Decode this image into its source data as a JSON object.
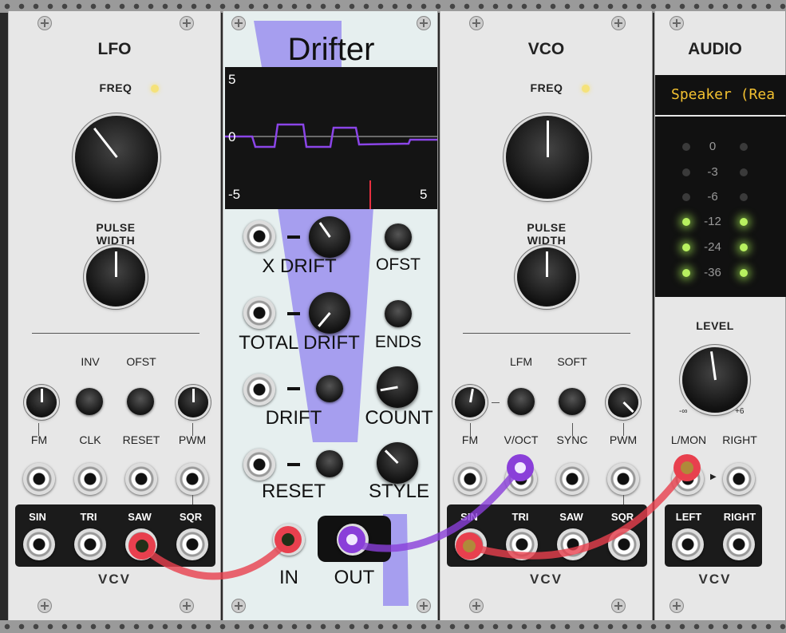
{
  "lfo": {
    "title": "LFO",
    "freq_label": "FREQ",
    "pw_label": "PULSE WIDTH",
    "inv_label": "INV",
    "ofst_label": "OFST",
    "fm_label": "FM",
    "clk_label": "CLK",
    "reset_label": "RESET",
    "pwm_label": "PWM",
    "outputs": [
      "SIN",
      "TRI",
      "SAW",
      "SQR"
    ],
    "brand": "VCV"
  },
  "drifter": {
    "title": "Drifter",
    "display": {
      "y_top": "5",
      "y_mid": "0",
      "x_left": "-5",
      "x_right": "5"
    },
    "x_drift_label": "X DRIFT",
    "ofst_label": "OFST",
    "total_drift_label": "TOTAL DRIFT",
    "ends_label": "ENDS",
    "drift_label": "DRIFT",
    "count_label": "COUNT",
    "reset_label": "RESET",
    "style_label": "STYLE",
    "in_label": "IN",
    "out_label": "OUT",
    "colors": {
      "accent": "#8a7cf0",
      "trace": "#8b45e8",
      "cursor": "#e83040"
    }
  },
  "vco": {
    "title": "VCO",
    "freq_label": "FREQ",
    "pw_label": "PULSE WIDTH",
    "lfm_label": "LFM",
    "soft_label": "SOFT",
    "fm_label": "FM",
    "voct_label": "V/OCT",
    "sync_label": "SYNC",
    "pwm_label": "PWM",
    "outputs": [
      "SIN",
      "TRI",
      "SAW",
      "SQR"
    ],
    "brand": "VCV"
  },
  "audio": {
    "title": "AUDIO",
    "device": "Speaker (Rea",
    "meter_labels": [
      "0",
      "-3",
      "-6",
      "-12",
      "-24",
      "-36"
    ],
    "level_label": "LEVEL",
    "level_min": "-∞",
    "level_max": "+6",
    "lmon_label": "L/MON",
    "right_label": "RIGHT",
    "out_left_label": "LEFT",
    "out_right_label": "RIGHT",
    "brand": "VCV"
  },
  "cables": {
    "red": "#e8404e",
    "purple": "#8a3fd9"
  }
}
